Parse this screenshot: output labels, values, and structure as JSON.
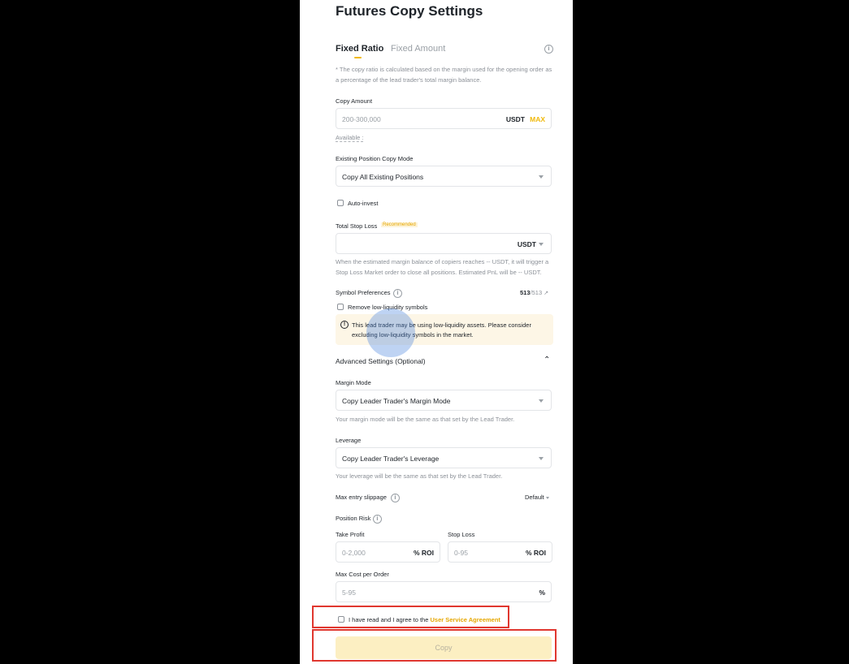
{
  "page": {
    "title": "Futures Copy Settings",
    "tabs": [
      {
        "label": "Fixed Ratio",
        "active": true
      },
      {
        "label": "Fixed Amount",
        "active": false
      }
    ],
    "ratio_note": "* The copy ratio is calculated based on the margin used for the opening order as a percentage of the lead trader's total margin balance.",
    "copy_amount": {
      "label": "Copy Amount",
      "placeholder": "200-300,000",
      "unit": "USDT",
      "max_label": "MAX",
      "available_label": "Available :"
    },
    "existing_position": {
      "label": "Existing Position Copy Mode",
      "value": "Copy All Existing Positions"
    },
    "auto_invest_label": "Auto-invest",
    "total_stop_loss": {
      "label": "Total Stop Loss",
      "badge": "Recommended",
      "unit": "USDT",
      "note": "When the estimated margin balance of copiers reaches -- USDT, it will trigger a Stop Loss Market order to close all positions. Estimated PnL will be -- USDT."
    },
    "symbol_preferences": {
      "label": "Symbol Preferences",
      "count_selected": "513",
      "count_total": "/513",
      "remove_low_liquidity_label": "Remove low-liquidity symbols",
      "warning": "This lead trader may be using low-liquidity assets. Please consider excluding low-liquidity symbols in the market."
    },
    "advanced": {
      "title": "Advanced Settings (Optional)",
      "margin_mode": {
        "label": "Margin Mode",
        "value": "Copy Leader Trader's Margin Mode",
        "note": "Your margin mode will be the same as that set by the Lead Trader."
      },
      "leverage": {
        "label": "Leverage",
        "value": "Copy Leader Trader's Leverage",
        "note": "Your leverage will be the same as that set by the Lead Trader."
      },
      "max_entry_slippage": {
        "label": "Max entry slippage",
        "value": "Default"
      },
      "position_risk": {
        "label": "Position Risk",
        "take_profit_label": "Take Profit",
        "take_profit_placeholder": "0-2,000",
        "take_profit_unit": "% ROI",
        "stop_loss_label": "Stop Loss",
        "stop_loss_placeholder": "0-95",
        "stop_loss_unit": "% ROI"
      },
      "max_cost": {
        "label": "Max Cost per Order",
        "placeholder": "5-95",
        "unit": "%"
      }
    },
    "agreement": {
      "prefix": "I have read and I agree to the ",
      "link": "User Service Agreement"
    },
    "copy_button": "Copy"
  },
  "colors": {
    "accent": "#f0b90b",
    "badge": "#e6a700",
    "highlight_box": "#e0372f"
  }
}
